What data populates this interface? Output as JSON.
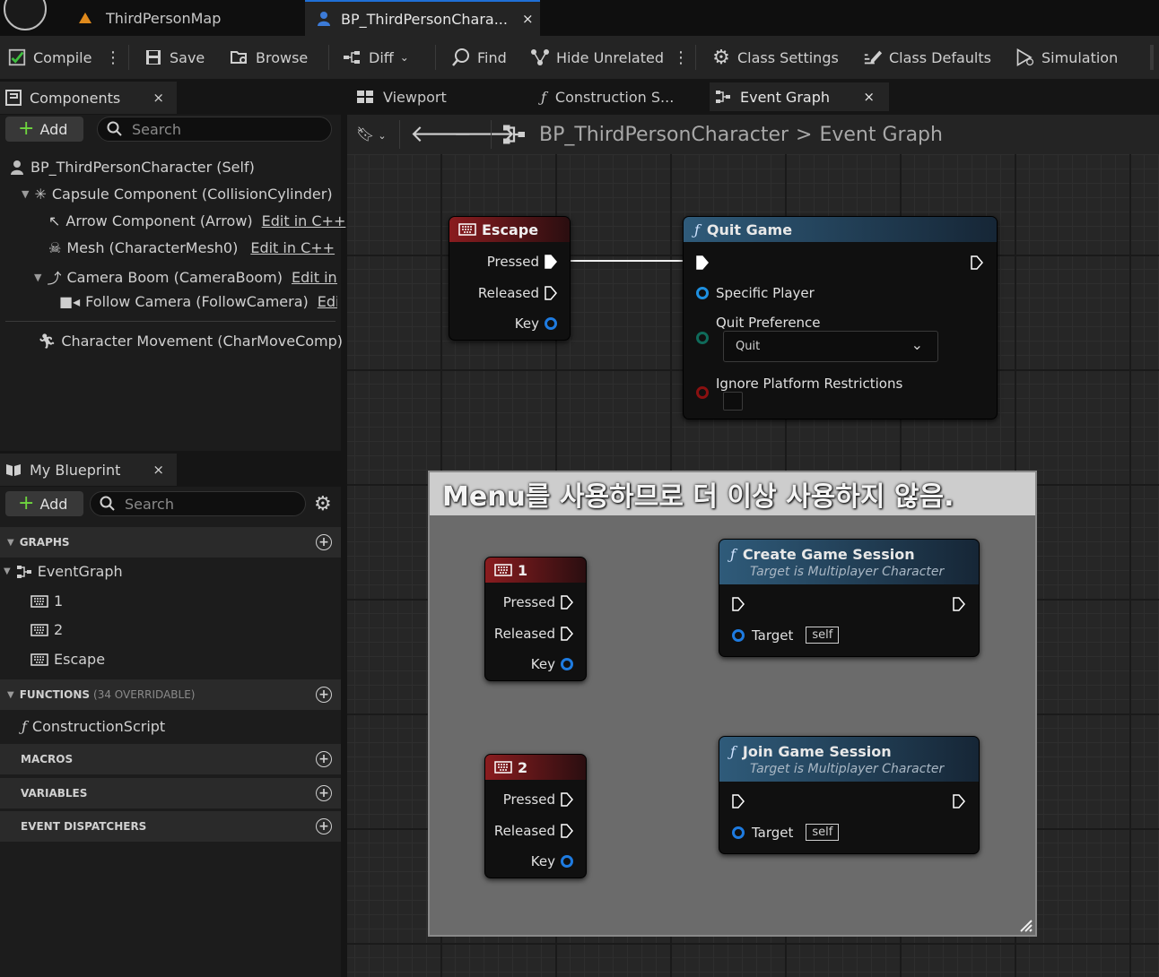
{
  "window": {
    "tabs": [
      {
        "label": "ThirdPersonMap"
      },
      {
        "label": "BP_ThirdPersonChara...",
        "close": "×"
      }
    ]
  },
  "toolbar": {
    "compile": "Compile",
    "save": "Save",
    "browse": "Browse",
    "diff": "Diff",
    "find": "Find",
    "hide_unrelated": "Hide Unrelated",
    "class_settings": "Class Settings",
    "class_defaults": "Class Defaults",
    "simulation": "Simulation"
  },
  "components_panel": {
    "tab_label": "Components",
    "close": "×",
    "add_label": "Add",
    "search_placeholder": "Search",
    "items": [
      {
        "label": "BP_ThirdPersonCharacter (Self)"
      },
      {
        "label": "Capsule Component (CollisionCylinder)"
      },
      {
        "label": "Arrow Component (Arrow)",
        "edit": "Edit in C++"
      },
      {
        "label": "Mesh (CharacterMesh0)",
        "edit": "Edit in C++"
      },
      {
        "label": "Camera Boom (CameraBoom)",
        "edit": "Edit in C"
      },
      {
        "label": "Follow Camera (FollowCamera)",
        "edit": "Edit"
      },
      {
        "label": "Character Movement (CharMoveComp)"
      }
    ]
  },
  "my_blueprint": {
    "tab_label": "My Blueprint",
    "close": "×",
    "add_label": "Add",
    "search_placeholder": "Search",
    "graphs_header": "GRAPHS",
    "event_graph": "EventGraph",
    "events": [
      "1",
      "2",
      "Escape"
    ],
    "functions_header": "FUNCTIONS",
    "functions_sub": "(34 OVERRIDABLE)",
    "construction_script": "ConstructionScript",
    "macros_header": "MACROS",
    "variables_header": "VARIABLES",
    "dispatchers_header": "EVENT DISPATCHERS"
  },
  "graph_tabs": [
    {
      "label": "Viewport"
    },
    {
      "label": "Construction S..."
    },
    {
      "label": "Event Graph",
      "close": "×"
    }
  ],
  "breadcrumb": {
    "blueprint": "BP_ThirdPersonCharacter",
    "separator": ">",
    "graph": "Event Graph"
  },
  "nodes": {
    "escape": {
      "title": "Escape",
      "pressed": "Pressed",
      "released": "Released",
      "key": "Key"
    },
    "quit_game": {
      "title": "Quit Game",
      "specific_player": "Specific Player",
      "quit_preference": "Quit Preference",
      "quit_value": "Quit",
      "ignore_platform": "Ignore Platform Restrictions"
    },
    "key1": {
      "title": "1",
      "pressed": "Pressed",
      "released": "Released",
      "key": "Key"
    },
    "key2": {
      "title": "2",
      "pressed": "Pressed",
      "released": "Released",
      "key": "Key"
    },
    "create_session": {
      "title": "Create Game Session",
      "subtitle": "Target is Multiplayer Character",
      "target": "Target",
      "self": "self"
    },
    "join_session": {
      "title": "Join Game Session",
      "subtitle": "Target is Multiplayer Character",
      "target": "Target",
      "self": "self"
    }
  },
  "comment": {
    "text": "Menu를 사용하므로 더 이상 사용하지 않음."
  },
  "colors": {
    "accent": "#1f6fd6",
    "event_header": "#8a1c1f",
    "function_header": "#2f5b7a",
    "object_pin": "#1e7be0"
  }
}
